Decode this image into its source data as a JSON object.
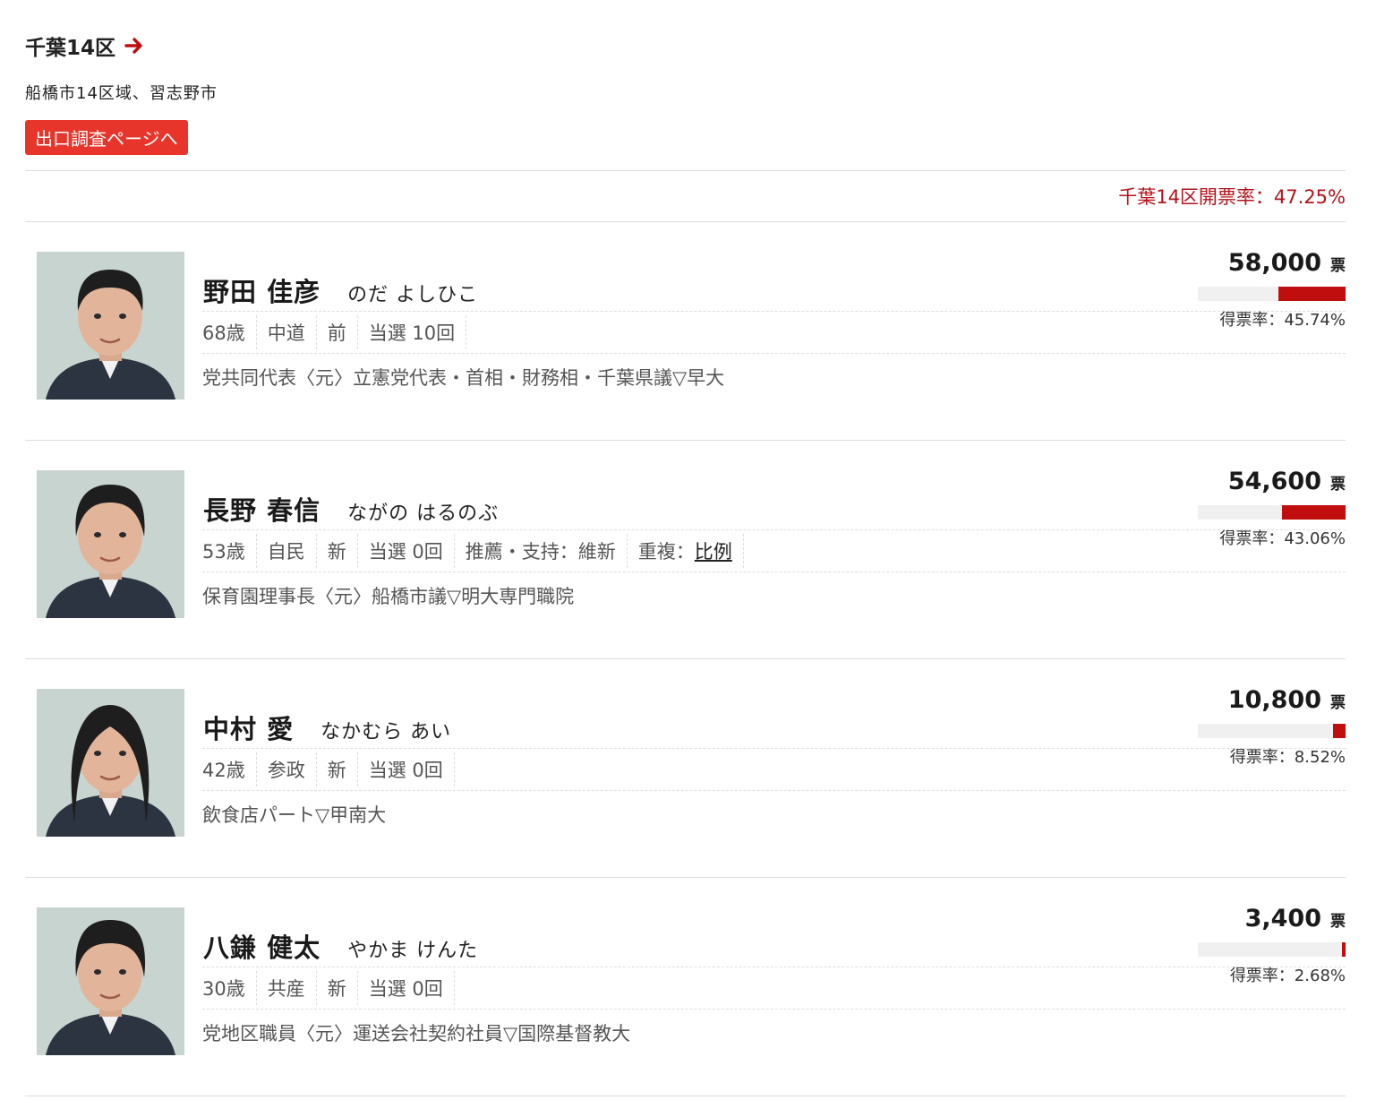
{
  "district": {
    "title": "千葉14区",
    "area": "船橋市14区域、習志野市",
    "exit_poll_button": "出口調査ページへ",
    "turnout": "千葉14区開票率：47.25%"
  },
  "colors": {
    "accent": "#e8352b",
    "bar": "#c00d0d",
    "turnout_text": "#b3121b"
  },
  "candidates": [
    {
      "name": "野田 佳彦",
      "kana": "のだ よしひこ",
      "age": "68歳",
      "party": "中道",
      "status": "前",
      "elected": "当選 10回",
      "endorsement": "",
      "duplicate_label": "",
      "duplicate_link": "",
      "career": "党共同代表〈元〉立憲党代表・首相・財務相・千葉県議▽早大",
      "votes": "58,000",
      "votes_unit": "票",
      "rate": "得票率：45.74%",
      "share": 45.74,
      "photo": "candidate-photo"
    },
    {
      "name": "長野 春信",
      "kana": "ながの はるのぶ",
      "age": "53歳",
      "party": "自民",
      "status": "新",
      "elected": "当選 0回",
      "endorsement": "推薦・支持：維新",
      "duplicate_label": "重複：",
      "duplicate_link": "比例",
      "career": "保育園理事長〈元〉船橋市議▽明大専門職院",
      "votes": "54,600",
      "votes_unit": "票",
      "rate": "得票率：43.06%",
      "share": 43.06,
      "photo": "candidate-photo"
    },
    {
      "name": "中村 愛",
      "kana": "なかむら あい",
      "age": "42歳",
      "party": "参政",
      "status": "新",
      "elected": "当選 0回",
      "endorsement": "",
      "duplicate_label": "",
      "duplicate_link": "",
      "career": "飲食店パート▽甲南大",
      "votes": "10,800",
      "votes_unit": "票",
      "rate": "得票率：8.52%",
      "share": 8.52,
      "photo": "candidate-photo"
    },
    {
      "name": "八鎌 健太",
      "kana": "やかま けんた",
      "age": "30歳",
      "party": "共産",
      "status": "新",
      "elected": "当選 0回",
      "endorsement": "",
      "duplicate_label": "",
      "duplicate_link": "",
      "career": "党地区職員〈元〉運送会社契約社員▽国際基督教大",
      "votes": "3,400",
      "votes_unit": "票",
      "rate": "得票率：2.68%",
      "share": 2.68,
      "photo": "candidate-photo"
    }
  ]
}
